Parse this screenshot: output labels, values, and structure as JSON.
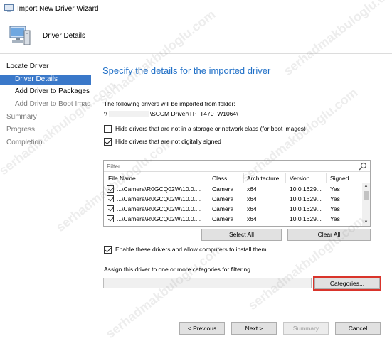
{
  "window": {
    "title": "Import New Driver Wizard"
  },
  "header": {
    "title": "Driver Details"
  },
  "nav": {
    "items": [
      {
        "label": "Locate Driver",
        "level": 0,
        "state": "enabled"
      },
      {
        "label": "Driver Details",
        "level": 1,
        "state": "active"
      },
      {
        "label": "Add Driver to Packages",
        "level": 1,
        "state": "enabled"
      },
      {
        "label": "Add Driver to Boot Images",
        "level": 1,
        "state": "disabled"
      },
      {
        "label": "Summary",
        "level": 0,
        "state": "disabled"
      },
      {
        "label": "Progress",
        "level": 0,
        "state": "disabled"
      },
      {
        "label": "Completion",
        "level": 0,
        "state": "disabled"
      }
    ]
  },
  "main": {
    "heading": "Specify the details for the imported driver",
    "folder_description": "The following drivers will be imported from folder:",
    "folder_path_prefix": "\\\\",
    "folder_path_suffix": "\\SCCM Driver\\TP_T470_W1064\\",
    "hide_storage_label": "Hide drivers that are not in a storage or network class (for boot images)",
    "hide_storage_checked": false,
    "hide_unsigned_label": "Hide drivers that are not digitally signed",
    "hide_unsigned_checked": true,
    "filter_placeholder": "Filter...",
    "columns": [
      "File Name",
      "Class",
      "Architecture",
      "Version",
      "Signed"
    ],
    "rows": [
      {
        "checked": true,
        "file": "...\\Camera\\R0GCQ02W\\10.0....",
        "class": "Camera",
        "arch": "x64",
        "version": "10.0.1629...",
        "signed": "Yes"
      },
      {
        "checked": true,
        "file": "...\\Camera\\R0GCQ02W\\10.0....",
        "class": "Camera",
        "arch": "x64",
        "version": "10.0.1629...",
        "signed": "Yes"
      },
      {
        "checked": true,
        "file": "...\\Camera\\R0GCQ02W\\10.0....",
        "class": "Camera",
        "arch": "x64",
        "version": "10.0.1629...",
        "signed": "Yes"
      },
      {
        "checked": true,
        "file": "...\\Camera\\R0GCQ02W\\10.0....",
        "class": "Camera",
        "arch": "x64",
        "version": "10.0.1629...",
        "signed": "Yes"
      }
    ],
    "select_all_label": "Select All",
    "clear_all_label": "Clear All",
    "enable_label": "Enable these drivers and allow computers to install them",
    "enable_checked": true,
    "assign_label": "Assign this driver to one or more categories for filtering.",
    "categories_value": "",
    "categories_button": "Categories..."
  },
  "footer": {
    "previous": "< Previous",
    "next": "Next >",
    "summary": "Summary",
    "cancel": "Cancel"
  },
  "watermark": "serhadmakbuloglu.com",
  "colors": {
    "accent": "#3a78c9",
    "heading": "#1f6fc7",
    "highlight": "#d9342b"
  }
}
